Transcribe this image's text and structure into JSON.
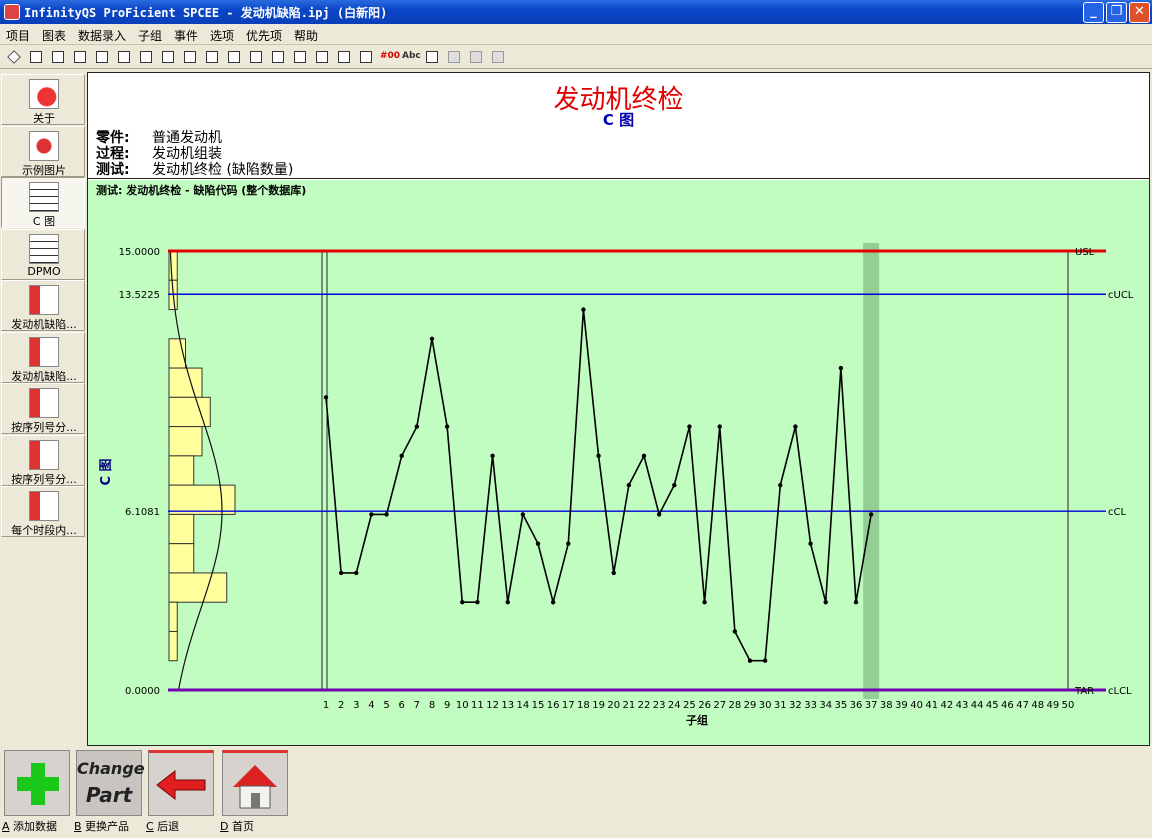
{
  "window": {
    "title": "InfinityQS ProFicient SPCEE - 发动机缺陷.ipj (白新阳)"
  },
  "menu": [
    "项目",
    "图表",
    "数据录入",
    "子组",
    "事件",
    "选项",
    "优先项",
    "帮助"
  ],
  "toolbar": [
    "diamond-icon",
    "tag-icon",
    "save-icon",
    "print-icon",
    "print-preview-icon",
    "grid-icon",
    "report-icon",
    "chart-icon",
    "histogram-icon",
    "list-icon",
    "summary-icon",
    "notes-icon",
    "capture-icon",
    "wand-icon",
    "table-icon",
    "table-icon",
    "barcode-icon",
    "hash-00-icon",
    "abc-icon",
    "recalc-icon",
    "copy-icon",
    "layout-icon",
    "split-icon"
  ],
  "toolbar_text": {
    "hash": "#00",
    "abc": "Abc"
  },
  "sidebar": {
    "items": [
      {
        "label": "关于",
        "icon": "globe-icon"
      },
      {
        "label": "示例图片",
        "icon": "picture-icon"
      },
      {
        "label": "C 图",
        "icon": "control-chart-icon",
        "active": true
      },
      {
        "label": "DPMO",
        "icon": "control-chart-icon"
      },
      {
        "label": "发动机缺陷...",
        "icon": "pareto-icon"
      },
      {
        "label": "发动机缺陷...",
        "icon": "pareto-icon"
      },
      {
        "label": "按序列号分...",
        "icon": "pareto-icon"
      },
      {
        "label": "按序列号分...",
        "icon": "pareto-icon"
      },
      {
        "label": "每个时段内...",
        "icon": "pareto-icon"
      }
    ]
  },
  "report": {
    "title": "发动机终检",
    "subtitle": "C 图",
    "part_key": "零件:",
    "part": "普通发动机",
    "process_key": "过程:",
    "process": "发动机组装",
    "test_key": "测试:",
    "test": "发动机终检 (缺陷数量)",
    "caption": "测试: 发动机终检 - 缺陷代码 (整个数据库)"
  },
  "chart_data": {
    "type": "line",
    "ylabel": "C 图",
    "xlabel": "子组",
    "ylim": [
      0,
      15
    ],
    "xlim": [
      1,
      50
    ],
    "x": [
      1,
      2,
      3,
      4,
      5,
      6,
      7,
      8,
      9,
      10,
      11,
      12,
      13,
      14,
      15,
      16,
      17,
      18,
      19,
      20,
      21,
      22,
      23,
      24,
      25,
      26,
      27,
      28,
      29,
      30,
      31,
      32,
      33,
      34,
      35,
      36,
      37
    ],
    "values": [
      10,
      4,
      4,
      6,
      6,
      8,
      9,
      12,
      9,
      3,
      3,
      8,
      3,
      6,
      5,
      3,
      5,
      13,
      8,
      4,
      7,
      8,
      6,
      7,
      9,
      3,
      9,
      2,
      1,
      1,
      7,
      9,
      5,
      3,
      11,
      3,
      6
    ],
    "highlighted_x": 37,
    "limits": [
      {
        "name": "USL",
        "value": 15.0,
        "label": "15.0000",
        "color": "#e00000"
      },
      {
        "name": "cUCL",
        "value": 13.5225,
        "label": "13.5225",
        "color": "#0000e0"
      },
      {
        "name": "cCL",
        "value": 6.1081,
        "label": "6.1081",
        "color": "#0000e0"
      },
      {
        "name": "cLCL",
        "value": 0.0,
        "label": "0.0000",
        "color": "#0000e0"
      }
    ],
    "target_label": "TAR",
    "histogram": {
      "bins": [
        [
          14,
          15,
          1
        ],
        [
          13,
          14,
          1
        ],
        [
          11,
          12,
          2
        ],
        [
          10,
          11,
          4
        ],
        [
          9,
          10,
          5
        ],
        [
          8,
          9,
          4
        ],
        [
          7,
          8,
          3
        ],
        [
          6,
          7,
          8
        ],
        [
          5,
          6,
          3
        ],
        [
          4,
          5,
          3
        ],
        [
          3,
          4,
          7
        ],
        [
          2,
          3,
          1
        ],
        [
          1,
          2,
          1
        ],
        [
          0,
          1,
          0
        ]
      ]
    }
  },
  "bottom": {
    "buttons": [
      {
        "key": "A",
        "label": "添加数据",
        "icon": "plus-icon"
      },
      {
        "key": "B",
        "label": "更换产品",
        "icon": "change-part-icon",
        "face": [
          "Change",
          "Part"
        ]
      },
      {
        "key": "C",
        "label": "后退",
        "icon": "back-arrow-icon"
      },
      {
        "key": "D",
        "label": "首页",
        "icon": "home-icon"
      }
    ]
  }
}
